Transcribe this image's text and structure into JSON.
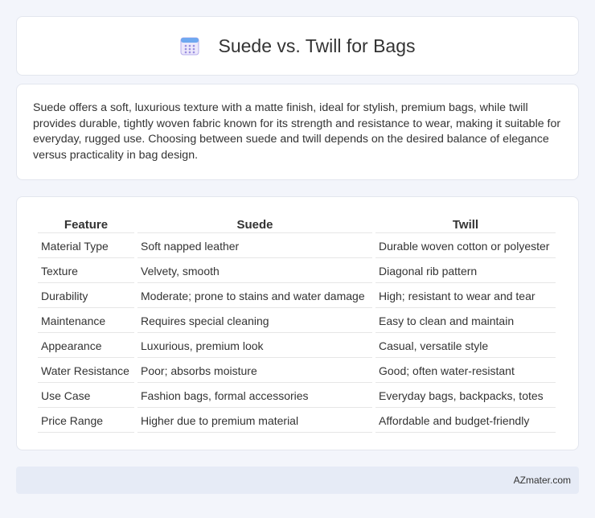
{
  "header": {
    "title": "Suede vs. Twill for Bags",
    "icon": "calendar-icon"
  },
  "intro": {
    "text": "Suede offers a soft, luxurious texture with a matte finish, ideal for stylish, premium bags, while twill provides durable, tightly woven fabric known for its strength and resistance to wear, making it suitable for everyday, rugged use. Choosing between suede and twill depends on the desired balance of elegance versus practicality in bag design."
  },
  "table": {
    "headers": [
      "Feature",
      "Suede",
      "Twill"
    ],
    "rows": [
      [
        "Material Type",
        "Soft napped leather",
        "Durable woven cotton or polyester"
      ],
      [
        "Texture",
        "Velvety, smooth",
        "Diagonal rib pattern"
      ],
      [
        "Durability",
        "Moderate; prone to stains and water damage",
        "High; resistant to wear and tear"
      ],
      [
        "Maintenance",
        "Requires special cleaning",
        "Easy to clean and maintain"
      ],
      [
        "Appearance",
        "Luxurious, premium look",
        "Casual, versatile style"
      ],
      [
        "Water Resistance",
        "Poor; absorbs moisture",
        "Good; often water-resistant"
      ],
      [
        "Use Case",
        "Fashion bags, formal accessories",
        "Everyday bags, backpacks, totes"
      ],
      [
        "Price Range",
        "Higher due to premium material",
        "Affordable and budget-friendly"
      ]
    ]
  },
  "footer": {
    "brand": "AZmater.com"
  },
  "colors": {
    "page_bg": "#f3f5fb",
    "footer_bg": "#e6ebf6",
    "icon_accent": "#8a7fd8"
  }
}
